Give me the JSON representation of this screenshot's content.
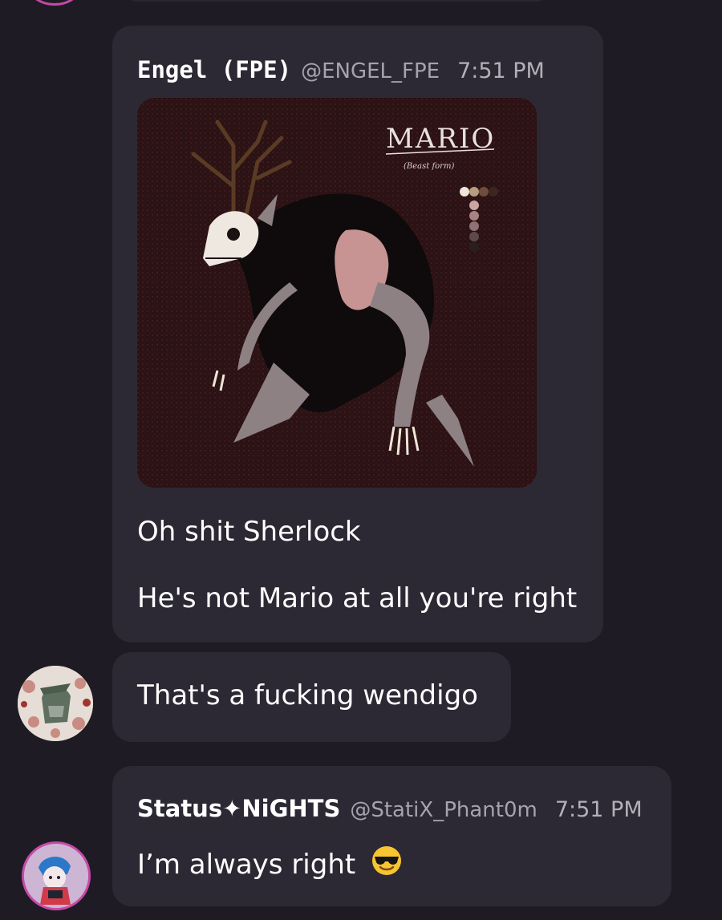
{
  "messages": [
    {
      "author": "Engel (FPE)",
      "handle": "@ENGEL_FPE",
      "time": "7:51 PM",
      "attachment": {
        "title": "MARIO",
        "subtitle": "(Beast form)"
      },
      "lines": [
        "Oh shit Sherlock",
        "He's not Mario at all you're right"
      ]
    },
    {
      "lines": [
        "That's a fucking wendigo"
      ]
    },
    {
      "author": "Status✦NiGHTS",
      "handle": "@StatiX_Phant0m",
      "time": "7:51 PM",
      "lines": [
        "I’m always right"
      ],
      "emoji": "smiling-face-with-sunglasses"
    }
  ],
  "colors": {
    "background": "#1e1b24",
    "bubble": "#2c2934",
    "avatar_ring": "#c54aa6"
  }
}
